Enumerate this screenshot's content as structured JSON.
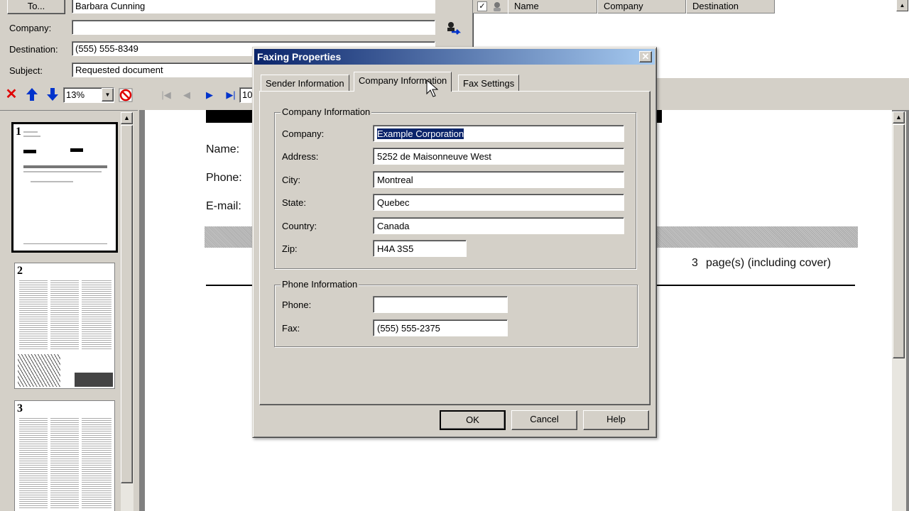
{
  "header": {
    "to_button": "To...",
    "to_value": "Barbara Cunning",
    "company_label": "Company:",
    "company_value": "",
    "destination_label": "Destination:",
    "destination_value": "(555) 555-8349",
    "subject_label": "Subject:",
    "subject_value": "Requested document"
  },
  "recipients": {
    "columns": [
      "Name",
      "Company",
      "Destination"
    ]
  },
  "toolbar": {
    "zoom": "13%",
    "page_field": "10"
  },
  "thumbnails": [
    "1",
    "2",
    "3"
  ],
  "preview": {
    "name_label": "Name:",
    "phone_label": "Phone:",
    "email_label": "E-mail:",
    "pages_count": "3",
    "pages_text": "page(s) (including cover)"
  },
  "dialog": {
    "title": "Faxing Properties",
    "close": "✕",
    "tabs": [
      "Sender Information",
      "Company Information",
      "Fax Settings"
    ],
    "company_group": {
      "title": "Company Information",
      "company_label": "Company:",
      "company_value": "Example Corporation",
      "address_label": "Address:",
      "address_value": "5252 de Maisonneuve West",
      "city_label": "City:",
      "city_value": "Montreal",
      "state_label": "State:",
      "state_value": "Quebec",
      "country_label": "Country:",
      "country_value": "Canada",
      "zip_label": "Zip:",
      "zip_value": "H4A 3S5"
    },
    "phone_group": {
      "title": "Phone Information",
      "phone_label": "Phone:",
      "phone_value": "",
      "fax_label": "Fax:",
      "fax_value": "(555) 555-2375"
    },
    "buttons": {
      "ok": "OK",
      "cancel": "Cancel",
      "help": "Help"
    }
  },
  "colors": {
    "titlebar_start": "#0a246a",
    "titlebar_end": "#a6caf0",
    "selection": "#0a246a",
    "toolbar_arrow": "#0033cc",
    "delete_red": "#e00000"
  }
}
